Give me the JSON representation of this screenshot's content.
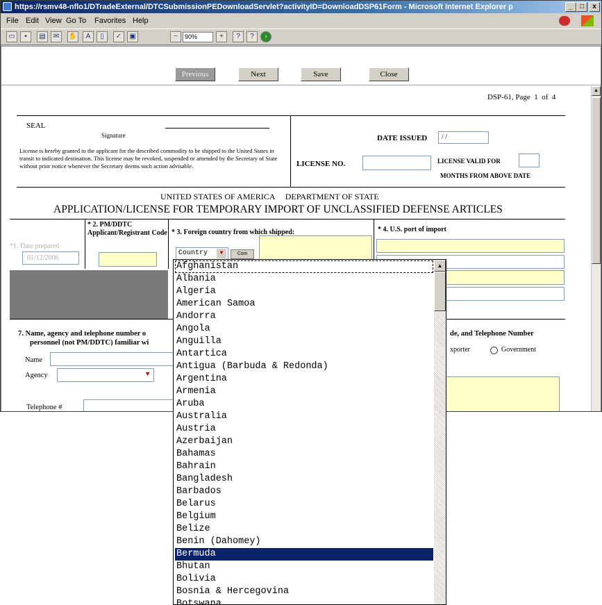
{
  "window": {
    "title": "https://rsmv48-nflo1/DTradeExternal/DTCSubmissionPEDownloadServlet?activityID=DownloadDSP61Form - Microsoft Internet Explorer p",
    "minimize": "_",
    "maximize": "□",
    "close": "x"
  },
  "menu": [
    "File",
    "Edit",
    "View",
    "Go To",
    "Favorites",
    "Help"
  ],
  "toolbar": {
    "zoom": "90%"
  },
  "nav": {
    "previous": "Previous",
    "next": "Next",
    "save": "Save",
    "close": "Close"
  },
  "page_info": {
    "label": "DSP-61, Page",
    "current": "1",
    "of": "of",
    "total": "4"
  },
  "seal": {
    "seal": "SEAL",
    "signature": "Signature",
    "license_text": "License is hereby granted to the applicant for the described commodity to be shipped to the United States in transit to indicated destination.  This license may be revoked, suspended or amended by the Secretary of State without prior notice whenever the Secretary deems such action advisable."
  },
  "license": {
    "date_issued_label": "DATE ISSUED",
    "date_issued_value": "/ /",
    "license_no_label": "LICENSE NO.",
    "valid_for_label": "LICENSE VALID FOR",
    "months_label": "MONTHS FROM ABOVE DATE"
  },
  "heading": {
    "agency": "UNITED STATES OF AMERICA     DEPARTMENT OF STATE",
    "title": "APPLICATION/LICENSE FOR TEMPORARY IMPORT OF UNCLASSIFIED DEFENSE ARTICLES"
  },
  "form": {
    "f1_label": "*1.  Date prepared",
    "f1_value": "01/12/2006",
    "f2_label": "* 2.  PM/DDTC Applicant/Registrant Code",
    "f3_label": "* 3.  Foreign country from which shipped:",
    "f3_select": "Country",
    "f3_button": "Com",
    "f4_label": "* 4. U.S. port of import",
    "f5_partial": "xport",
    "f7_label_line1": "7.  Name, agency and telephone number o",
    "f7_label_line2": "personnel (not PM/DDTC) familiar wi",
    "name_label": "Name",
    "agency_label": "Agency",
    "phone_label": "Telephone #",
    "f8_partial": "de, and Telephone Number",
    "exporter_partial": "xporter",
    "government_label": "Government"
  },
  "countries": {
    "selected": "Bermuda",
    "items": [
      "Afghanistan",
      "Albania",
      "Algeria",
      "American Samoa",
      "Andorra",
      "Angola",
      "Anguilla",
      "Antartica",
      "Antigua (Barbuda & Redonda)",
      "Argentina",
      "Armenia",
      "Aruba",
      "Australia",
      "Austria",
      "Azerbaijan",
      "Bahamas",
      "Bahrain",
      "Bangladesh",
      "Barbados",
      "Belarus",
      "Belgium",
      "Belize",
      "Benin (Dahomey)",
      "Bermuda",
      "Bhutan",
      "Bolivia",
      "Bosnia & Hercegovina",
      "Botswana"
    ]
  },
  "colors": {
    "title_bar": "#0a246a",
    "selection": "#0a246a",
    "input_yellow": "#ffffc8",
    "chrome": "#d4d0c8",
    "gray_block": "#7a7a7a"
  }
}
